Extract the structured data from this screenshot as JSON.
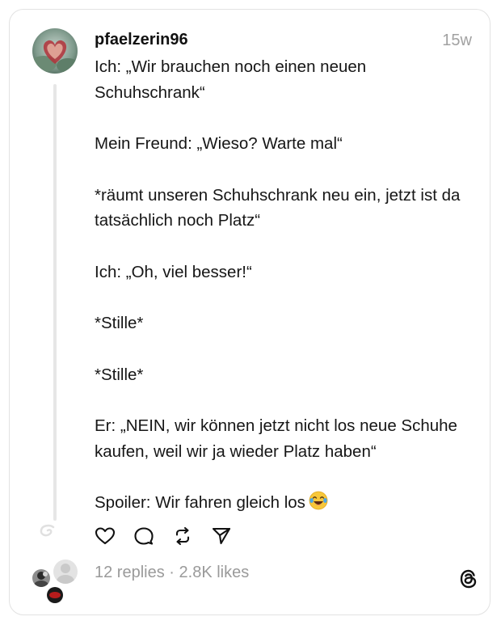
{
  "post": {
    "username": "pfaelzerin96",
    "time": "15w",
    "paragraphs": [
      "Ich: „Wir brauchen noch einen neuen Schuhschrank“",
      "Mein Freund: „Wieso? Warte mal“",
      "*räumt unseren Schuhschrank neu ein, jetzt ist da tatsächlich noch Platz“",
      "Ich: „Oh, viel besser!“",
      "*Stille*",
      "*Stille*",
      "Er: „NEIN, wir können jetzt nicht los neue Schuhe kaufen, weil wir ja wieder Platz haben“",
      "Spoiler: Wir fahren gleich los"
    ],
    "emoji": "laughing-tears-emoji"
  },
  "stats": {
    "replies": "12 replies",
    "separator": "·",
    "likes": "2.8K likes"
  },
  "icons": {
    "like": "heart-icon",
    "reply": "comment-icon",
    "repost": "repost-icon",
    "share": "send-icon",
    "brand": "threads-logo-icon"
  },
  "colors": {
    "text": "#111111",
    "muted": "#9a9a9a",
    "border": "#e2e2e2",
    "thread_line": "#e6e6e6"
  }
}
